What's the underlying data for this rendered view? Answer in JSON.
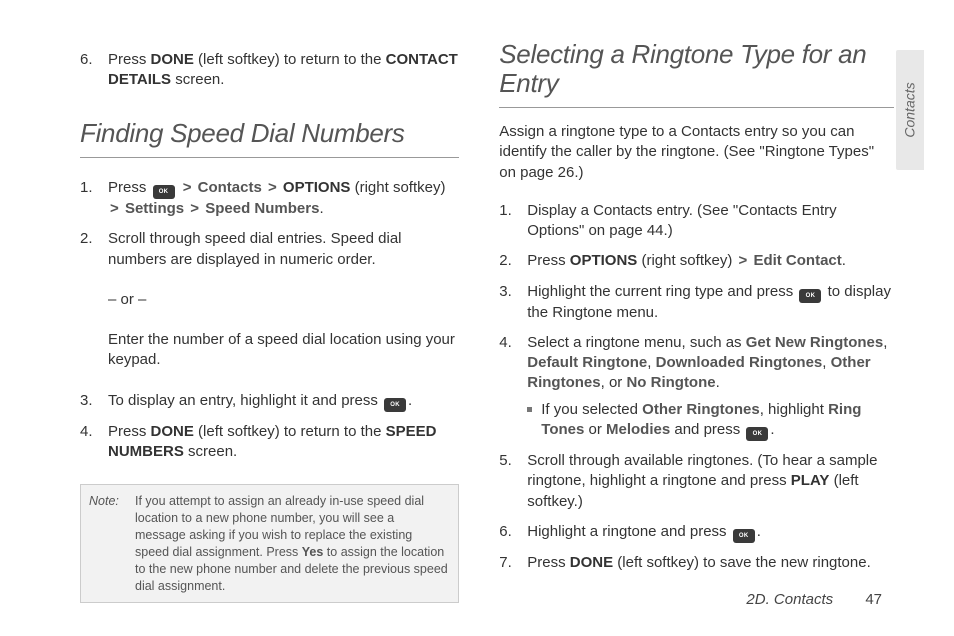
{
  "sideTab": "Contacts",
  "footer": {
    "chapter": "2D. Contacts",
    "page": "47"
  },
  "left": {
    "prevStep6": {
      "num": "6.",
      "t1": "Press ",
      "b1": "DONE",
      "t2": " (left softkey) to return to the ",
      "b2": "CONTACT DETAILS",
      "t3": " screen."
    },
    "heading": "Finding Speed Dial Numbers",
    "step1": {
      "num": "1.",
      "t1": "Press ",
      "gt1": ">",
      "b1": "Contacts",
      "gt2": ">",
      "b2": "OPTIONS",
      "t2": " (right softkey) ",
      "gt3": ">",
      "b3": "Settings",
      "gt4": ">",
      "b4": "Speed Numbers",
      "t3": "."
    },
    "step2": {
      "num": "2.",
      "t": "Scroll through speed dial entries. Speed dial numbers are displayed in numeric order."
    },
    "or": "– or –",
    "orText": "Enter the number of a speed dial location using your keypad.",
    "step3": {
      "num": "3.",
      "t1": "To display an entry, highlight it and press ",
      "t2": "."
    },
    "step4": {
      "num": "4.",
      "t1": "Press ",
      "b1": "DONE",
      "t2": " (left softkey) to return to the ",
      "b2": "SPEED NUMBERS",
      "t3": " screen."
    },
    "note": {
      "label": "Note:",
      "t1": "If you attempt to assign an already in-use speed dial location to a new phone number, you will see a message asking if you wish to replace the existing speed dial assignment. Press ",
      "b1": "Yes",
      "t2": " to assign the location to the new phone number and delete the previous speed dial assignment."
    }
  },
  "right": {
    "heading": "Selecting a Ringtone Type for an Entry",
    "intro": "Assign a ringtone type to a Contacts entry so you can identify the caller by the ringtone. (See \"Ringtone Types\" on page 26.)",
    "step1": {
      "num": "1.",
      "t": "Display a Contacts entry. (See \"Contacts Entry Options\" on page 44.)"
    },
    "step2": {
      "num": "2.",
      "t1": "Press ",
      "b1": "OPTIONS",
      "t2": " (right softkey) ",
      "gt": ">",
      "b2": "Edit Contact",
      "t3": "."
    },
    "step3": {
      "num": "3.",
      "t1": "Highlight the current ring type and press ",
      "t2": " to display the Ringtone menu."
    },
    "step4": {
      "num": "4.",
      "t1": "Select a ringtone menu, such as ",
      "b1": "Get New Ringtones",
      "c1": ", ",
      "b2": "Default Ringtone",
      "c2": ", ",
      "b3": "Downloaded Ringtones",
      "c3": ", ",
      "b4": "Other Ringtones",
      "c4": ", or ",
      "b5": "No Ringtone",
      "t2": "."
    },
    "sub": {
      "t1": "If you selected ",
      "b1": "Other Ringtones",
      "t2": ", highlight ",
      "b2": "Ring Tones",
      "t3": " or ",
      "b3": "Melodies",
      "t4": " and press ",
      "t5": "."
    },
    "step5": {
      "num": "5.",
      "t1": "Scroll through available ringtones. (To hear a sample ringtone, highlight a ringtone and press ",
      "b1": "PLAY",
      "t2": " (left softkey.)"
    },
    "step6": {
      "num": "6.",
      "t1": "Highlight a ringtone and press ",
      "t2": "."
    },
    "step7": {
      "num": "7.",
      "t1": "Press ",
      "b1": "DONE",
      "t2": " (left softkey) to save the new ringtone."
    }
  }
}
